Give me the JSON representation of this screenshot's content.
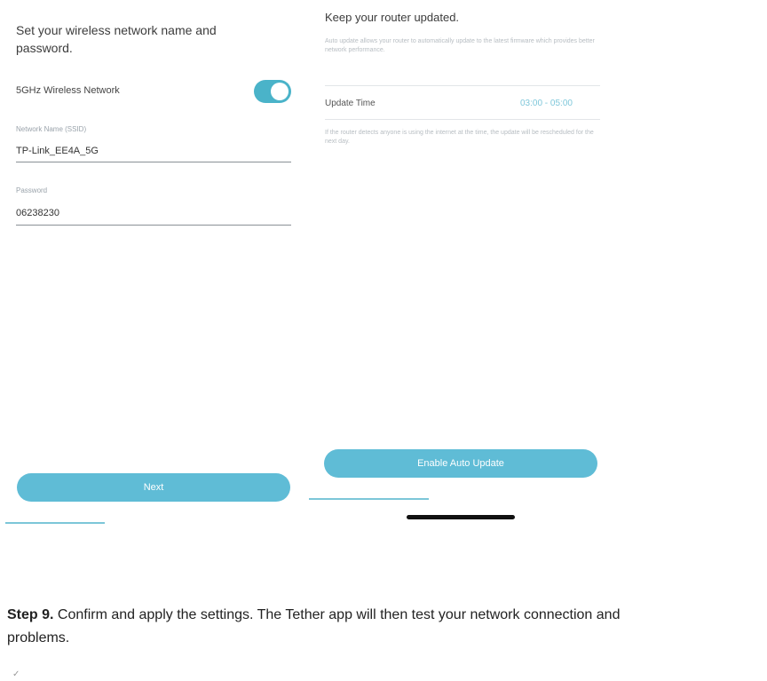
{
  "wifi_setup": {
    "title": "Set your wireless network name and password.",
    "band_label": "5GHz Wireless Network",
    "band_enabled": true,
    "network_name_label": "Network Name (SSID)",
    "network_name_value": "TP-Link_EE4A_5G",
    "password_label": "Password",
    "password_value": "06238230",
    "next_button": "Next",
    "progress_fraction": 0.33
  },
  "auto_update": {
    "title": "Keep your router updated.",
    "description": "Auto update allows your router to automatically update to the latest firmware which provides better network performance.",
    "update_time_label": "Update Time",
    "update_time_value": "03:00 - 05:00",
    "note": "If the router detects anyone is using the internet at the time, the update will be rescheduled for the next day.",
    "enable_button": "Enable Auto Update",
    "progress_fraction": 0.4
  },
  "caption": {
    "step_label": "Step 9.",
    "text": " Confirm and apply the settings. The Tether app will then test your network connection and",
    "line2": "problems."
  },
  "colors": {
    "accent": "#4ab3c9",
    "button": "#5fbcd6",
    "time_value": "#7fc7da"
  }
}
